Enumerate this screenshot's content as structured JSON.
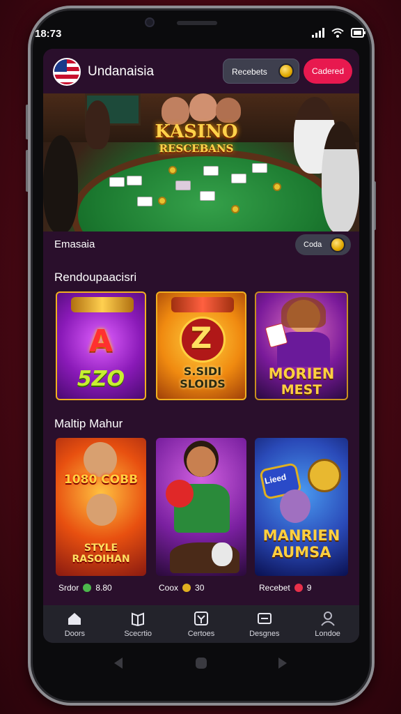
{
  "status_bar": {
    "time": "18:73"
  },
  "header": {
    "brand": "Undanaisia",
    "button_label": "Recebets",
    "cta_label": "Cadered"
  },
  "hero": {
    "title_line1": "KASINO",
    "title_line2": "RESCEBANS"
  },
  "subbar": {
    "label": "Emasaia",
    "pill_label": "Coda"
  },
  "section1": {
    "title": "Rendoupaacisri",
    "tiles": [
      {
        "line1": "A",
        "line2": "5ZO"
      },
      {
        "line1": "Z",
        "line2": "S.SIDI SLOIDS"
      },
      {
        "line1": "MORIEN",
        "line2": "MEST"
      }
    ]
  },
  "section2": {
    "title": "Maltip Mahur",
    "tiles": [
      {
        "line1": "1080 COBB",
        "line2": "STYLE RASOIHAN"
      },
      {
        "line1": "",
        "line2": ""
      },
      {
        "line1": "Lieed",
        "line2": "MANRIEN AUMSA"
      }
    ],
    "captions": [
      {
        "label": "Srdor",
        "value": "8.80",
        "dot": "#4cb84c"
      },
      {
        "label": "Coox",
        "value": "30",
        "dot": "#e0b020"
      },
      {
        "label": "Recebet",
        "value": "9",
        "dot": "#e8304a"
      }
    ]
  },
  "nav": [
    {
      "label": "Doors",
      "icon": "home-icon"
    },
    {
      "label": "Scecrtio",
      "icon": "gift-icon"
    },
    {
      "label": "Certoes",
      "icon": "tree-icon"
    },
    {
      "label": "Desgnes",
      "icon": "card-icon"
    },
    {
      "label": "Londoe",
      "icon": "user-icon"
    }
  ],
  "colors": {
    "accent": "#e8194f",
    "background": "#2a0f2c",
    "nav_bg": "#23232b"
  }
}
